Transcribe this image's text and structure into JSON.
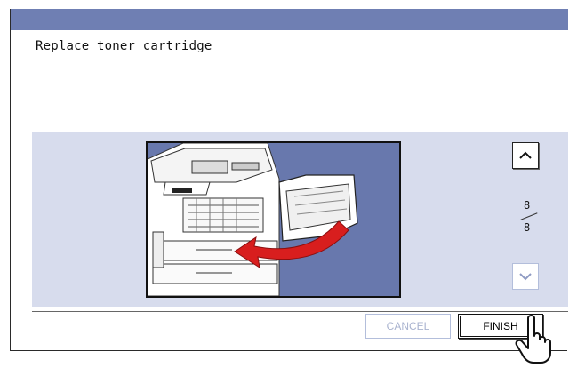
{
  "dialog": {
    "message": "Replace toner cartridge"
  },
  "pager": {
    "current": "8",
    "total": "8",
    "up_icon": "chevron-up-icon",
    "down_icon": "chevron-down-icon"
  },
  "buttons": {
    "cancel_label": "CANCEL",
    "finish_label": "FINISH"
  },
  "colors": {
    "titlebar": "#6f7fb3",
    "panel": "#d7dced",
    "illustration_background": "#6878ad",
    "arrow": "#d81e1e",
    "disabled_text": "#a9b3cf"
  }
}
